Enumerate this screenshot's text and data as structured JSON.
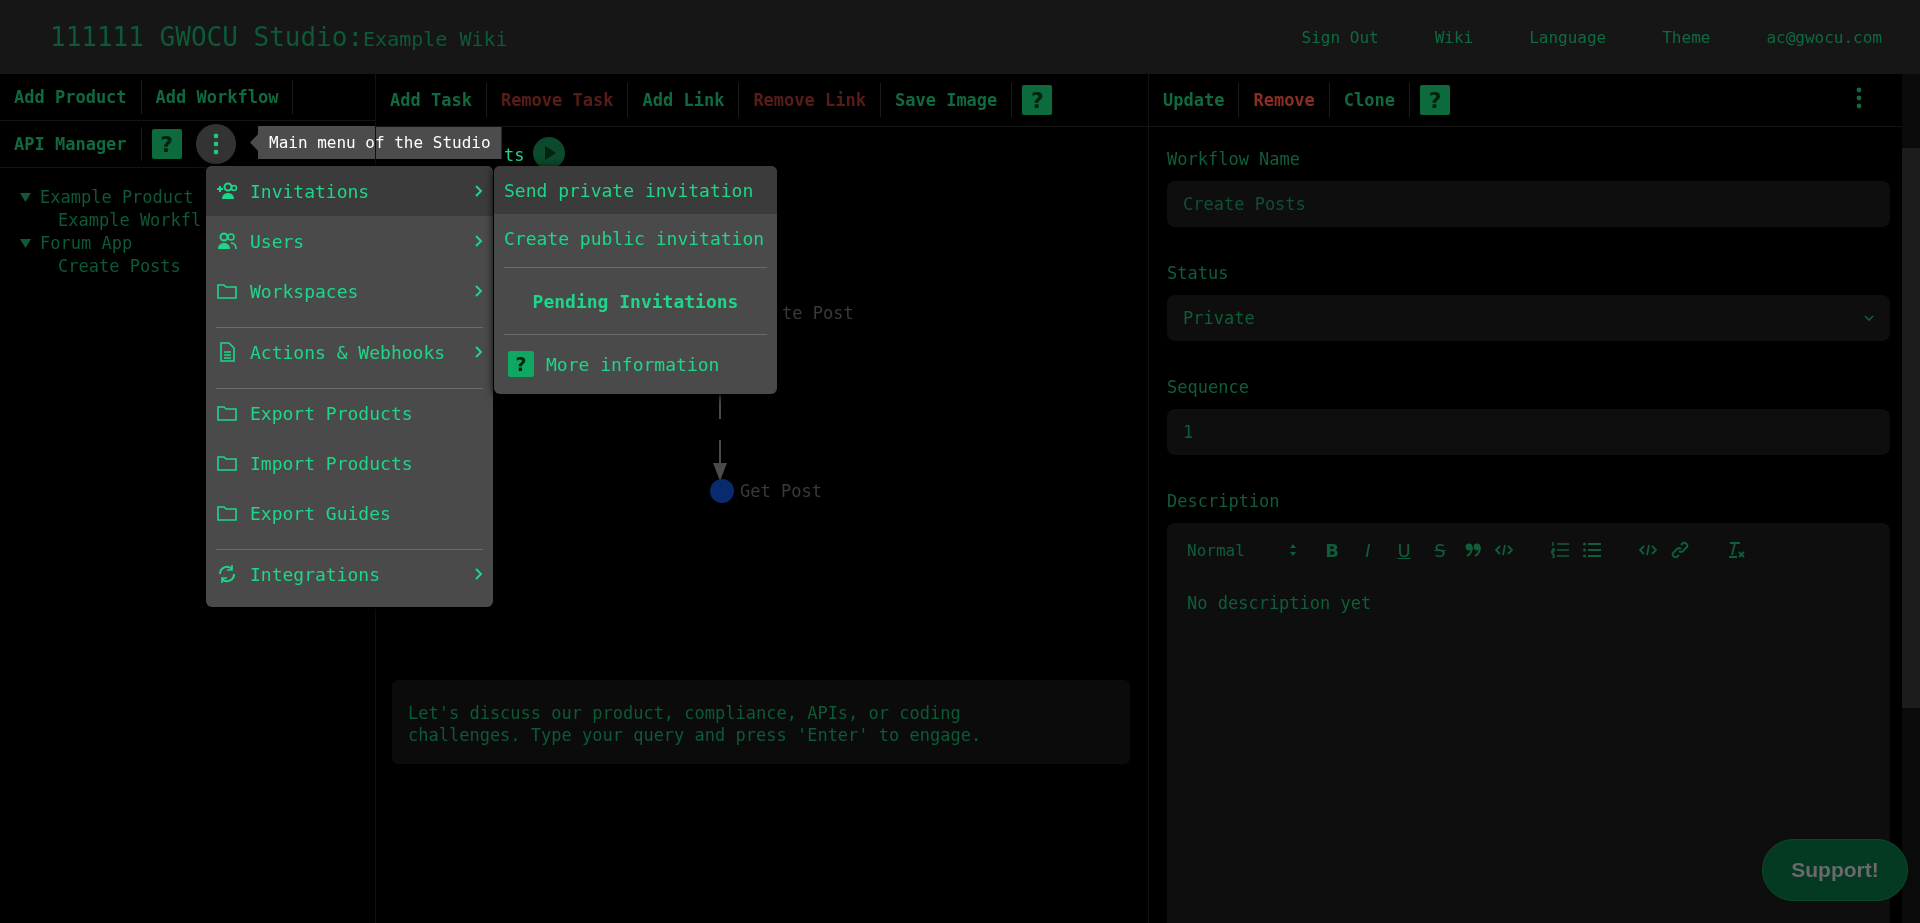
{
  "header": {
    "title": "111111 GWOCU Studio:",
    "subtitle": "Example Wiki",
    "links": [
      "Sign Out",
      "Wiki",
      "Language",
      "Theme"
    ],
    "email": "ac@gwocu.com"
  },
  "left_toolbar": {
    "row_1": [
      {
        "label": "Add Product"
      },
      {
        "label": "Add Workflow"
      }
    ],
    "row_2": [
      {
        "label": "API Manager"
      }
    ],
    "help": "?",
    "tooltip": "Main menu of the Studio"
  },
  "tree": [
    {
      "label": "Example Product",
      "expanded": true,
      "children": [
        {
          "label": "Example Workfl"
        }
      ]
    },
    {
      "label": "Forum App",
      "expanded": true,
      "children": [
        {
          "label": "Create Posts"
        }
      ]
    }
  ],
  "main_menu": [
    {
      "label": "Invitations",
      "submenu": true,
      "highlighted": true,
      "divider_before": false
    },
    {
      "label": "Users",
      "submenu": true,
      "highlighted": false,
      "divider_before": false
    },
    {
      "label": "Workspaces",
      "submenu": true,
      "highlighted": false,
      "divider_before": false
    },
    {
      "label": "Actions & Webhooks",
      "submenu": true,
      "highlighted": false,
      "divider_before": true
    },
    {
      "label": "Export Products",
      "submenu": false,
      "highlighted": false,
      "divider_before": true
    },
    {
      "label": "Import Products",
      "submenu": false,
      "highlighted": false,
      "divider_before": false
    },
    {
      "label": "Export Guides",
      "submenu": false,
      "highlighted": false,
      "divider_before": false
    },
    {
      "label": "Integrations",
      "submenu": true,
      "highlighted": false,
      "divider_before": true
    }
  ],
  "submenu": [
    {
      "kind": "item",
      "label": "Send private invitation",
      "highlighted": true
    },
    {
      "kind": "item",
      "label": "Create public invitation",
      "highlighted": false
    },
    {
      "kind": "heading",
      "label": "Pending Invitations",
      "highlighted": false
    },
    {
      "kind": "help",
      "label": "More information",
      "icon_label": "?",
      "highlighted": false
    }
  ],
  "center_toolbar": {
    "buttons": [
      {
        "label": "Add Task",
        "danger": false
      },
      {
        "label": "Remove Task",
        "danger": true
      },
      {
        "label": "Add Link",
        "danger": false
      },
      {
        "label": "Remove Link",
        "danger": true
      },
      {
        "label": "Save Image",
        "danger": false
      }
    ],
    "help": "?"
  },
  "diagram": {
    "title": "ts",
    "nodes": [
      {
        "label": "te Post"
      },
      {
        "label": "Get Post"
      }
    ]
  },
  "chat": {
    "placeholder": "Let's discuss our product, compliance, APIs, or coding challenges. Type your query and press 'Enter' to engage."
  },
  "right_toolbar": {
    "buttons": [
      {
        "label": "Update",
        "danger": false
      },
      {
        "label": "Remove",
        "danger": true
      },
      {
        "label": "Clone",
        "danger": false
      }
    ],
    "help": "?"
  },
  "form": {
    "fields": [
      {
        "kind": "text",
        "label": "Workflow Name",
        "value": "Create Posts"
      },
      {
        "kind": "select",
        "label": "Status",
        "value": "Private"
      },
      {
        "kind": "text",
        "label": "Sequence",
        "value": "1"
      }
    ],
    "description": {
      "label": "Description",
      "format": "Normal",
      "format_buttons": [
        "B",
        "I",
        "U",
        "S"
      ],
      "text": "No description yet"
    }
  },
  "support_button": "Support!"
}
